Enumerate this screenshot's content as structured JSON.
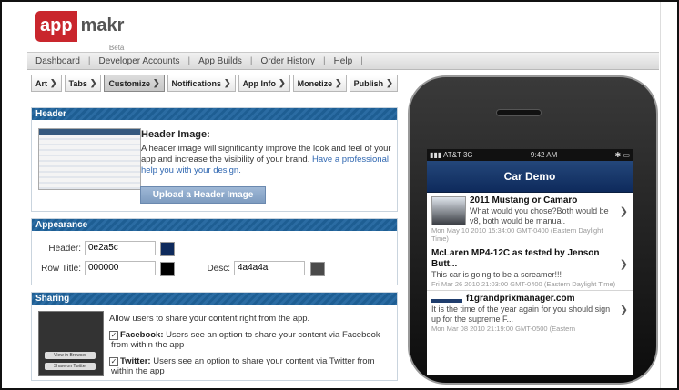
{
  "logo": {
    "app": "app",
    "makr": "makr",
    "beta": "Beta"
  },
  "nav": [
    "Dashboard",
    "Developer Accounts",
    "App Builds",
    "Order History",
    "Help"
  ],
  "steps": [
    "Art",
    "Tabs",
    "Customize",
    "Notifications",
    "App Info",
    "Monetize",
    "Publish"
  ],
  "active_step": "Customize",
  "header_section": {
    "title": "Header",
    "image_title": "Header Image:",
    "desc": "A header image will significantly improve the look and feel of your app and increase the visibility of your brand.",
    "link": "Have a professional help you with your design.",
    "button": "Upload a Header Image"
  },
  "appearance": {
    "title": "Appearance",
    "header_label": "Header:",
    "header_value": "0e2a5c",
    "header_color": "#0e2a5c",
    "row_title_label": "Row Title:",
    "row_title_value": "000000",
    "row_title_color": "#000000",
    "desc_label": "Desc:",
    "desc_value": "4a4a4a",
    "desc_color": "#4a4a4a"
  },
  "sharing": {
    "title": "Sharing",
    "intro": "Allow users to share your content right from the app.",
    "facebook_label": "Facebook:",
    "facebook_text": "Users see an option to share your content via Facebook from within the app",
    "twitter_label": "Twitter:",
    "twitter_text": "Users see an option to share your content via Twitter from within the app",
    "thumb_buttons": [
      "View in Browser",
      "Share on Twitter"
    ]
  },
  "phone": {
    "carrier": "AT&T",
    "network": "3G",
    "time": "9:42 AM",
    "app_title": "Car Demo",
    "items": [
      {
        "title": "2011 Mustang or Camaro",
        "snippet": "What would you chose?Both would be v8, both would be manual.",
        "date": "Mon May 10 2010 15:34:00 GMT-0400 (Eastern Daylight Time)"
      },
      {
        "title": "McLaren MP4-12C as tested by Jenson Butt...",
        "snippet": "This car is going to be a screamer!!!",
        "date": "Fri Mar 26 2010 21:03:00 GMT-0400 (Eastern Daylight Time)"
      },
      {
        "title": "f1grandprixmanager.com",
        "snippet": "It is the time of the year again for you should sign up for the supreme F...",
        "date": "Mon Mar 08 2010 21:19:00 GMT-0500 (Eastern"
      }
    ]
  },
  "colors": {
    "header_bar": "#1e5e93",
    "logo_red": "#c9262d",
    "link": "#2f67b1",
    "button": "#8aa6c9"
  }
}
